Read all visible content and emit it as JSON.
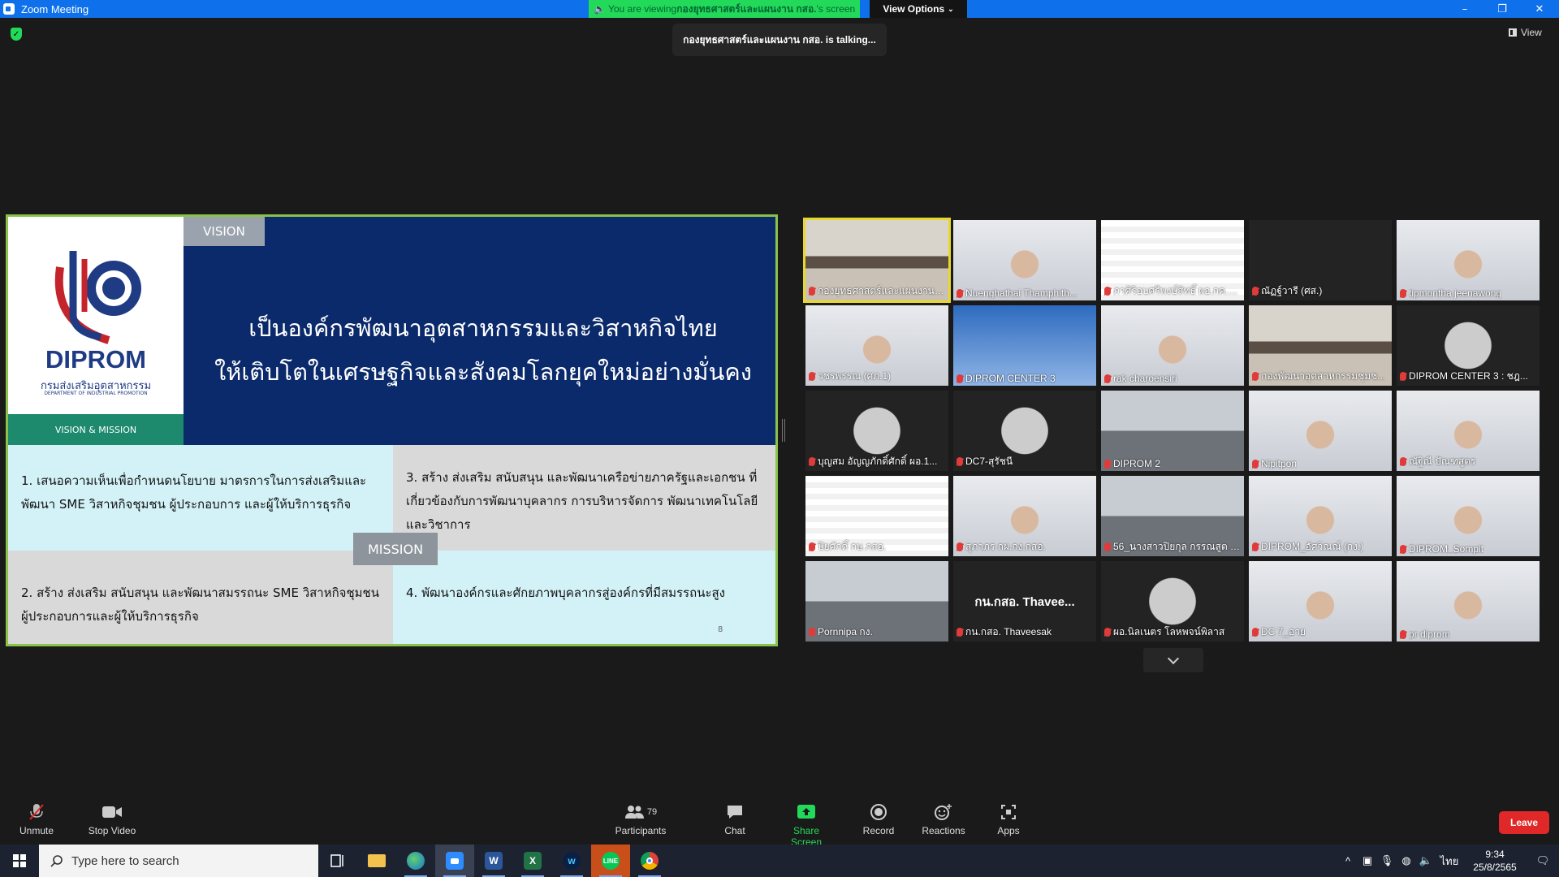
{
  "window": {
    "title": "Zoom Meeting",
    "share_banner_prefix": "You are viewing ",
    "share_banner_name": "กองยุทธศาสตร์และแผนงาน กสอ.",
    "share_banner_suffix": "'s screen",
    "view_options": "View Options",
    "controls": {
      "minimize": "–",
      "restore": "❐",
      "close": "✕"
    }
  },
  "top": {
    "talking": "กองยุทธศาสตร์และแผนงาน กสอ. is talking...",
    "view_label": "View"
  },
  "slide": {
    "vision_tag": "VISION",
    "vision_line1": "เป็นองค์กรพัฒนาอุตสาหกรรมและวิสาหกิจไทย",
    "vision_line2": "ให้เติบโตในเศรษฐกิจและสังคมโลกยุคใหม่อย่างมั่นคง",
    "logo_text": "DIPROM",
    "logo_sub": "กรมส่งเสริมอุตสาหกรรม",
    "logo_sub2": "DEPARTMENT OF INDUSTRIAL PROMOTION",
    "vm_label": "VISION & MISSION",
    "mission_tag": "MISSION",
    "mission1": "1. เสนอความเห็นเพื่อกำหนดนโยบาย มาตรการในการส่งเสริมและพัฒนา SME วิสาหกิจชุมชน ผู้ประกอบการ และผู้ให้บริการธุรกิจ",
    "mission2": "2. สร้าง ส่งเสริม สนับสนุน และพัฒนาสมรรถนะ SME วิสาหกิจชุมชน ผู้ประกอบการและผู้ให้บริการธุรกิจ",
    "mission3": "3. สร้าง ส่งเสริม สนับสนุน และพัฒนาเครือข่ายภาครัฐและเอกชน ที่เกี่ยวข้องกับการพัฒนาบุคลากร การบริหารจัดการ พัฒนาเทคโนโลยี และวิชาการ",
    "mission4": "4. พัฒนาองค์กรและศักยภาพบุคลากรสู่องค์กรที่มีสมรรถนะสูง",
    "page_number": "8"
  },
  "gallery": [
    {
      "name": "กองยุทธศาสตร์และแผนงาน ...",
      "bg": "bg-room",
      "active": true
    },
    {
      "name": "Nuenghathai Thamphith...",
      "bg": "bg-person"
    },
    {
      "name": "ภาศิริอบศรีพงษ์สิทธิ์ ผอ.กค.ก...",
      "bg": "bg-logo"
    },
    {
      "name": "ณัฏฐ์วารี (ศส.)",
      "bg": "bg-dark"
    },
    {
      "name": "tipmontha jeenawong",
      "bg": "bg-person"
    },
    {
      "name": "วชรพรรณ (ศภ.1)",
      "bg": "bg-person"
    },
    {
      "name": "DIPROM CENTER 3",
      "bg": "bg-blue"
    },
    {
      "name": "rak charoensiri",
      "bg": "bg-person"
    },
    {
      "name": "กองพัฒนาอุตสาหกรรมชุมช...",
      "bg": "bg-room"
    },
    {
      "name": "DIPROM CENTER 3 : ชฎ...",
      "bg": "bg-frame"
    },
    {
      "name": "บุญสม อัญญภักดิ์ศักดิ์ ผอ.1...",
      "bg": "bg-frame"
    },
    {
      "name": "DC7-สุรัชนี",
      "bg": "bg-frame"
    },
    {
      "name": "DIPROM 2",
      "bg": "bg-office"
    },
    {
      "name": "Nipitpon",
      "bg": "bg-person"
    },
    {
      "name": "ณัฐิณี ปัณฑสูตร",
      "bg": "bg-person"
    },
    {
      "name": "ปิยศักดิ์ กษ.กสอ.",
      "bg": "bg-logo"
    },
    {
      "name": "สุภาภร กผ.กง.กสอ.",
      "bg": "bg-person"
    },
    {
      "name": "56_นางสาวปิยกุล กรรณสูต (...",
      "bg": "bg-office"
    },
    {
      "name": "DIPROM_อัศวิณณ์ (กง.)",
      "bg": "bg-person"
    },
    {
      "name": "DIPROM_Sompit",
      "bg": "bg-person"
    },
    {
      "name": "Pornnipa กง.",
      "bg": "bg-office"
    },
    {
      "name": "กน.กสอ. Thaveesak",
      "bg": "bg-dark",
      "center": "กน.กสอ. Thavee..."
    },
    {
      "name": "ผอ.นิลเนตร โลหพจน์พิลาส",
      "bg": "bg-frame"
    },
    {
      "name": "DC 7_อาย",
      "bg": "bg-person"
    },
    {
      "name": "pr diprom",
      "bg": "bg-person"
    }
  ],
  "toolbar": {
    "unmute": "Unmute",
    "stop_video": "Stop Video",
    "participants": "Participants",
    "participants_count": "79",
    "chat": "Chat",
    "share_screen": "Share Screen",
    "record": "Record",
    "reactions": "Reactions",
    "apps": "Apps",
    "leave": "Leave"
  },
  "taskbar": {
    "search_placeholder": "Type here to search",
    "language": "ไทย",
    "time": "9:34",
    "date": "25/8/2565"
  },
  "colors": {
    "zoom_blue": "#0e71eb",
    "share_green": "#23d959",
    "leave_red": "#e02828",
    "active_border": "#e8d82b"
  }
}
